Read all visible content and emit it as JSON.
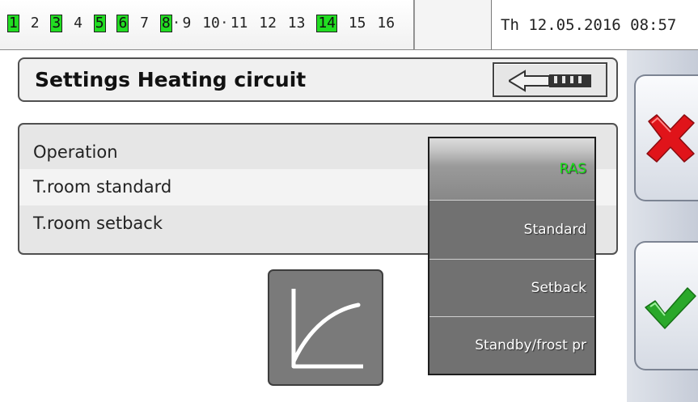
{
  "status_bar": {
    "outputs": [
      {
        "label": "1",
        "active": true
      },
      {
        "label": "2",
        "active": false
      },
      {
        "label": "3",
        "active": true
      },
      {
        "label": "4",
        "active": false
      },
      {
        "label": "5",
        "active": true
      },
      {
        "label": "6",
        "active": true
      },
      {
        "label": "7",
        "active": false
      },
      {
        "label": "8",
        "active": true
      },
      {
        "label": "9",
        "active": false
      },
      {
        "label": "10",
        "active": false
      },
      {
        "label": "11",
        "active": false
      },
      {
        "label": "12",
        "active": false
      },
      {
        "label": "13",
        "active": false
      },
      {
        "label": "14",
        "active": true
      },
      {
        "label": "15",
        "active": false
      },
      {
        "label": "16",
        "active": false
      }
    ],
    "output_on_color": "#22dd22",
    "datetime": "Th 12.05.2016 08:57"
  },
  "header": {
    "title": "Settings Heating circuit",
    "back_icon": "back-arrow-icon"
  },
  "params": [
    {
      "label": "Operation"
    },
    {
      "label": "T.room standard"
    },
    {
      "label": "T.room setback"
    }
  ],
  "curve_tile": {
    "icon": "heating-curve-icon"
  },
  "dropdown": {
    "items": [
      {
        "label": "RAS",
        "selected": true
      },
      {
        "label": "Standard",
        "selected": false
      },
      {
        "label": "Setback",
        "selected": false
      },
      {
        "label": "Standby/frost pr",
        "selected": false
      }
    ],
    "selected_color": "#18e018"
  },
  "side_buttons": {
    "cancel_icon": "red-x-icon",
    "confirm_icon": "green-check-icon",
    "cancel_color": "#e0141a",
    "confirm_color": "#2aa82a"
  }
}
